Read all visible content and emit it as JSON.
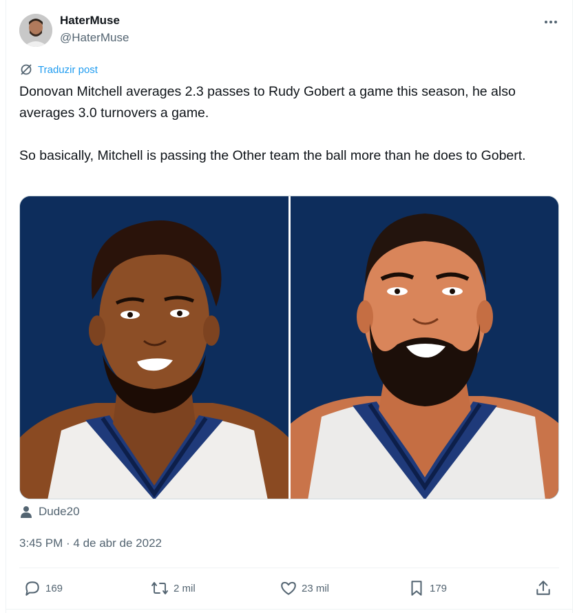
{
  "author": {
    "name": "HaterMuse",
    "handle": "@HaterMuse"
  },
  "translate_label": "Traduzir post",
  "tweet": {
    "paragraph1": "Donovan Mitchell averages 2.3 passes to Rudy Gobert a game this season, he also averages 3.0 turnovers a game.",
    "paragraph2": "So basically, Mitchell is passing the Other team the ball more than he does to Gobert."
  },
  "media_tag": "Dude20",
  "timestamp": {
    "time": "3:45 PM",
    "separator": " · ",
    "date": "4 de abr de 2022"
  },
  "actions": {
    "replies": "169",
    "reposts": "2 mil",
    "likes": "23 mil",
    "bookmarks": "179"
  },
  "colors": {
    "accent": "#1d9bf0",
    "secondary_text": "#536471",
    "media_background": "#0d2d5c"
  }
}
